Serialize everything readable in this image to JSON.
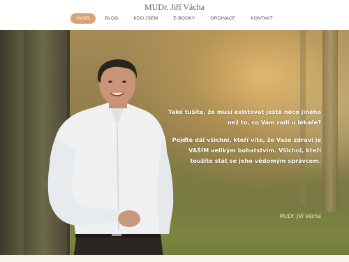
{
  "site": {
    "title": "MUDr. Jiří Vácha"
  },
  "nav": {
    "items": [
      {
        "label": "ÚVOD",
        "active": true
      },
      {
        "label": "BLOG",
        "active": false
      },
      {
        "label": "KDO JSEM",
        "active": false
      },
      {
        "label": "E-BOOKY",
        "active": false
      },
      {
        "label": "ORDINACE",
        "active": false
      },
      {
        "label": "KONTAKT",
        "active": false
      }
    ]
  },
  "hero": {
    "paragraph1": "Také tušíte, že musí existovat ještě něco jiného než to, co Vám radí u lékaře?",
    "paragraph2": "Pojďte dál všichni, kteří víte, že Vaše zdraví je VAŠÍM velikým bohatstvím. Všichni, kteří toužíte stát se jeho vědomým správcem.",
    "signature": "MUDr. Jiří Vácha"
  },
  "colors": {
    "accent": "#d9a276",
    "header_bg": "#ffffff",
    "hero_text": "#ffffff"
  }
}
